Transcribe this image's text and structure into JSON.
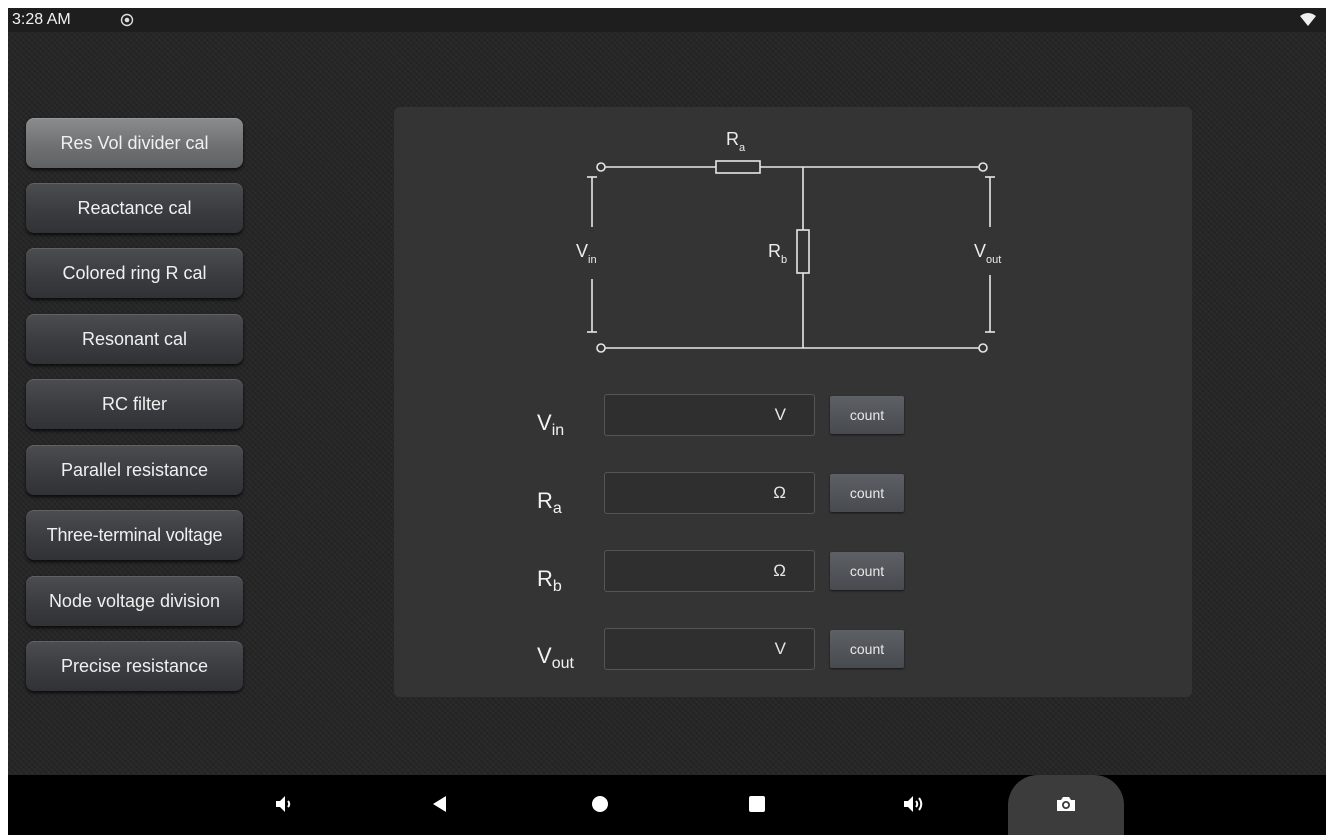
{
  "status_bar": {
    "time": "3:28 AM"
  },
  "sidebar": {
    "items": [
      {
        "label": "Res Vol divider cal",
        "active": true
      },
      {
        "label": "Reactance cal",
        "active": false
      },
      {
        "label": "Colored ring R cal",
        "active": false
      },
      {
        "label": "Resonant cal",
        "active": false
      },
      {
        "label": "RC filter",
        "active": false
      },
      {
        "label": "Parallel resistance",
        "active": false
      },
      {
        "label": "Three-terminal voltage",
        "active": false
      },
      {
        "label": "Node voltage division",
        "active": false
      },
      {
        "label": "Precise resistance",
        "active": false
      }
    ]
  },
  "circuit": {
    "ra": {
      "main": "R",
      "sub": "a"
    },
    "rb": {
      "main": "R",
      "sub": "b"
    },
    "vin": {
      "main": "V",
      "sub": "in"
    },
    "vout": {
      "main": "V",
      "sub": "out"
    }
  },
  "form": {
    "rows": [
      {
        "label_main": "V",
        "label_sub": "in",
        "value": "",
        "unit": "V",
        "button": "count"
      },
      {
        "label_main": "R",
        "label_sub": "a",
        "value": "",
        "unit": "Ω",
        "button": "count"
      },
      {
        "label_main": "R",
        "label_sub": "b",
        "value": "",
        "unit": "Ω",
        "button": "count"
      },
      {
        "label_main": "V",
        "label_sub": "out",
        "value": "",
        "unit": "V",
        "button": "count"
      }
    ]
  },
  "nav_bar": {
    "icons": [
      "volume-down-icon",
      "back-icon",
      "home-icon",
      "recents-icon",
      "volume-up-icon",
      "camera-icon"
    ]
  },
  "colors": {
    "background": "#262626",
    "panel": "#343434",
    "active_button": "#7a7c7e"
  }
}
